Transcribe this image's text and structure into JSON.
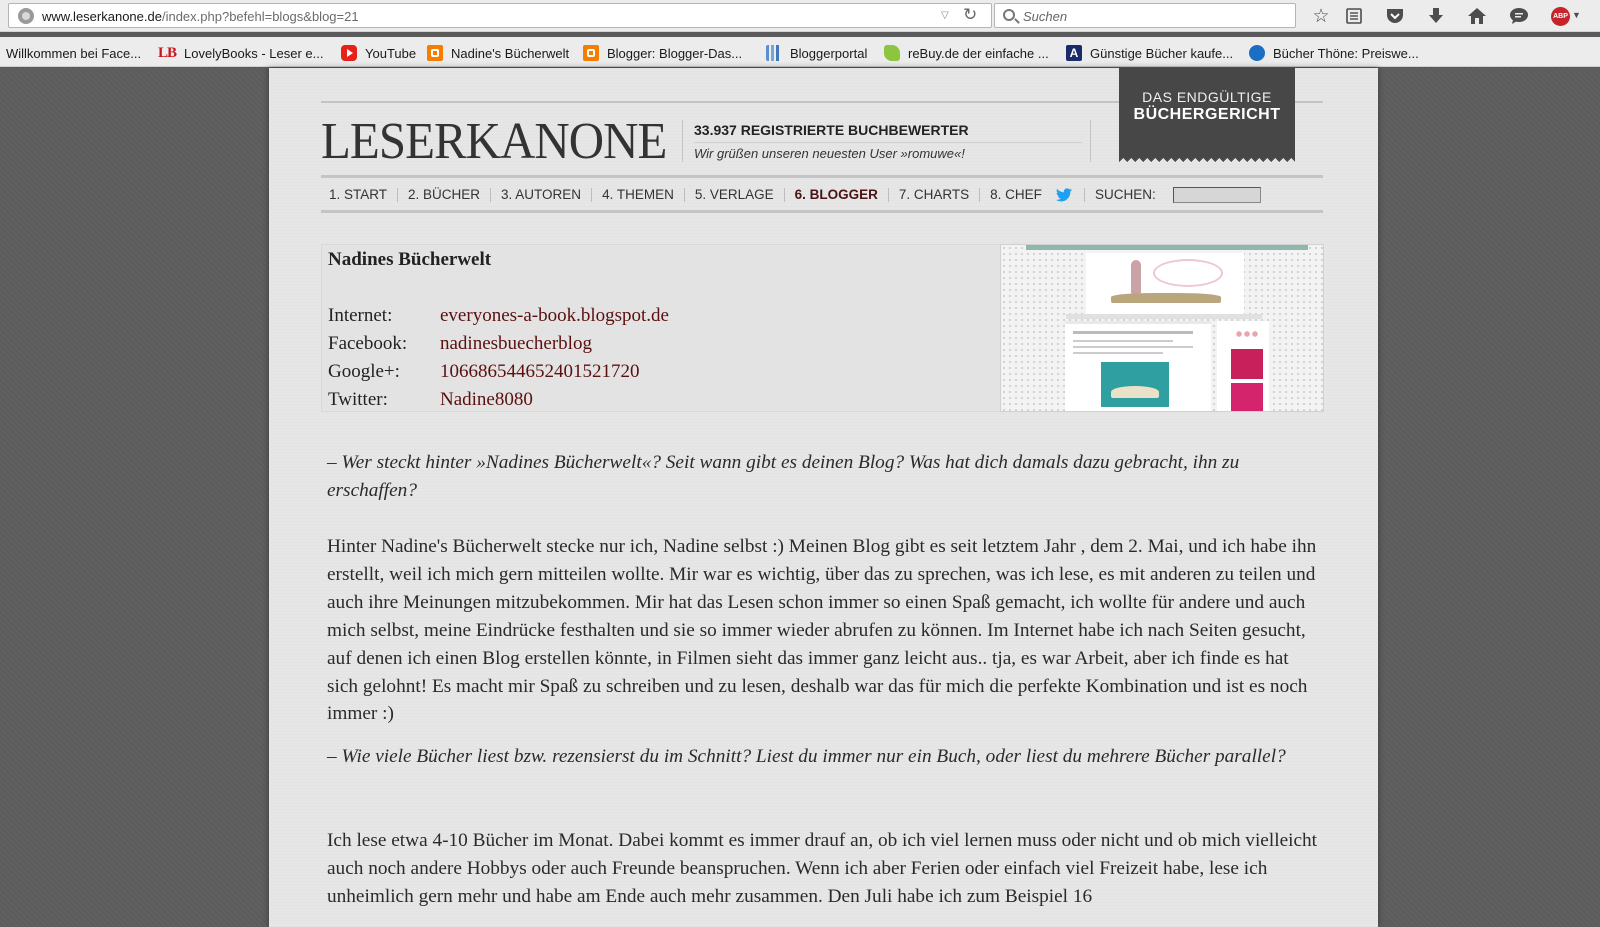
{
  "browser": {
    "url_host": "www.leserkanone.de",
    "url_path": "/index.php?befehl=blogs&blog=21",
    "search_placeholder": "Suchen",
    "icons": [
      "site-identity-icon",
      "bookmark-star-icon",
      "reading-list-icon",
      "pocket-icon",
      "download-icon",
      "home-icon",
      "chat-icon",
      "adblock-icon"
    ],
    "abp_label": "ABP"
  },
  "bookmarks": [
    {
      "label": "Willkommen bei Face...",
      "icon": "none"
    },
    {
      "label": "LovelyBooks - Leser e...",
      "icon": "lb",
      "icon_text": "LB"
    },
    {
      "label": "YouTube",
      "icon": "yt"
    },
    {
      "label": "Nadine's Bücherwelt",
      "icon": "blogger"
    },
    {
      "label": "Blogger: Blogger-Das...",
      "icon": "blogger"
    },
    {
      "label": "Bloggerportal",
      "icon": "portal"
    },
    {
      "label": "reBuy.de der einfache ...",
      "icon": "rebuy"
    },
    {
      "label": "Günstige Bücher kaufe...",
      "icon": "a",
      "icon_text": "A"
    },
    {
      "label": "Bücher Thöne: Preiswe...",
      "icon": "thone"
    }
  ],
  "site": {
    "logo": "LESERKANONE",
    "registered": "33.937 REGISTRIERTE BUCHBEWERTER",
    "greeting": "Wir grüßen unseren neuesten User »romuwe«!",
    "banner_line1": "DAS ENDGÜLTIGE",
    "banner_line2": "BÜCHERGERICHT",
    "nav": [
      {
        "label": "1. START",
        "active": false
      },
      {
        "label": "2. BÜCHER",
        "active": false
      },
      {
        "label": "3. AUTOREN",
        "active": false
      },
      {
        "label": "4. THEMEN",
        "active": false
      },
      {
        "label": "5. VERLAGE",
        "active": false
      },
      {
        "label": "6. BLOGGER",
        "active": true
      },
      {
        "label": "7. CHARTS",
        "active": false
      },
      {
        "label": "8. CHEF",
        "active": false
      }
    ],
    "search_label": "SUCHEN:",
    "twitter_color": "#1da1f2"
  },
  "profile": {
    "name": "Nadines Bücherwelt",
    "rows": [
      {
        "label": "Internet:",
        "value": "everyones-a-book.blogspot.de"
      },
      {
        "label": "Facebook:",
        "value": "nadinesbuecherblog"
      },
      {
        "label": "Google+:",
        "value": "106686544652401521720"
      },
      {
        "label": "Twitter:",
        "value": "Nadine8080"
      }
    ],
    "link_color": "#5b1010"
  },
  "article": {
    "q1": "– Wer steckt hinter »Nadines Bücherwelt«? Seit wann gibt es deinen Blog? Was hat dich damals dazu gebracht, ihn zu erschaffen?",
    "a1": "Hinter Nadine's Bücherwelt stecke nur ich, Nadine selbst :) Meinen Blog gibt es seit letztem Jahr , dem 2. Mai, und ich habe ihn erstellt, weil ich mich gern mitteilen wollte. Mir war es wichtig, über das zu sprechen, was ich lese, es mit anderen zu teilen und auch ihre Meinungen mitzubekommen. Mir hat das Lesen schon immer so einen Spaß gemacht, ich wollte für andere und auch mich selbst, meine Eindrücke festhalten und sie so immer wieder abrufen zu können. Im Internet habe ich nach Seiten gesucht, auf denen ich einen Blog erstellen könnte, in Filmen sieht das immer ganz leicht aus.. tja, es war Arbeit, aber ich finde es hat sich gelohnt! Es macht mir Spaß zu schreiben und zu lesen, deshalb war das für mich die perfekte Kombination und ist es noch immer :)",
    "q2": "– Wie viele Bücher liest bzw. rezensierst du im Schnitt? Liest du immer nur ein Buch, oder liest du mehrere Bücher parallel?",
    "a2": "Ich lese etwa 4-10 Bücher im Monat. Dabei kommt es immer drauf an, ob ich viel lernen muss oder nicht und ob mich vielleicht auch noch andere Hobbys oder auch Freunde beanspruchen. Wenn ich aber Ferien oder einfach viel Freizeit habe, lese ich unheimlich gern mehr und habe am Ende auch mehr zusammen. Den Juli habe ich zum Beispiel 16"
  }
}
